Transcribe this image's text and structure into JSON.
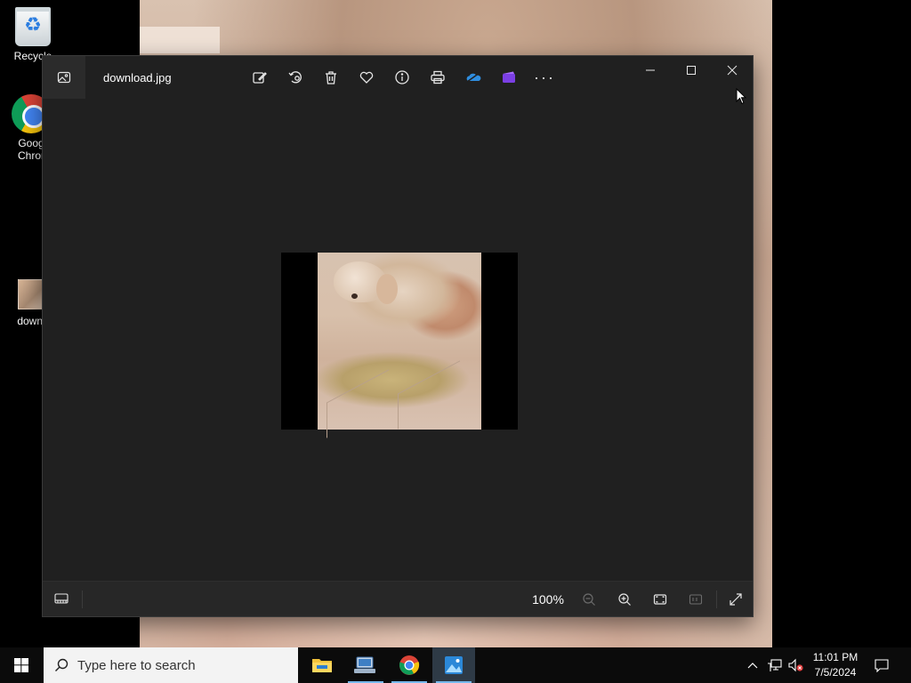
{
  "desktop": {
    "icons": [
      {
        "label": "Recycle",
        "icon": "recycle-bin-icon"
      },
      {
        "label": "Goog\nChror",
        "icon": "chrome-icon"
      },
      {
        "label": "downl",
        "icon": "image-file-icon"
      }
    ]
  },
  "window": {
    "title": "download.jpg",
    "toolbar": [
      {
        "name": "edit-create-button",
        "icon": "edit-create-icon"
      },
      {
        "name": "rotate-button",
        "icon": "rotate-icon"
      },
      {
        "name": "delete-button",
        "icon": "trash-icon"
      },
      {
        "name": "favorite-button",
        "icon": "heart-icon"
      },
      {
        "name": "info-button",
        "icon": "info-icon"
      },
      {
        "name": "print-button",
        "icon": "printer-icon"
      },
      {
        "name": "onedrive-button",
        "icon": "onedrive-icon"
      },
      {
        "name": "clipchamp-button",
        "icon": "clipchamp-icon"
      },
      {
        "name": "more-button",
        "icon": "more-icon",
        "label": "···"
      }
    ],
    "caption_buttons": [
      "minimize",
      "maximize",
      "close"
    ],
    "bottom_bar": {
      "zoom_level": "100%",
      "buttons": [
        "filmstrip",
        "zoom-out",
        "zoom-in",
        "fit-to-window",
        "actual-size",
        "full-screen"
      ]
    },
    "image": {
      "name": "download.jpg",
      "description_icon": "dog-photo"
    }
  },
  "taskbar": {
    "search_placeholder": "Type here to search",
    "apps": [
      {
        "name": "file-explorer",
        "running": false
      },
      {
        "name": "network-tool",
        "running": true
      },
      {
        "name": "chrome",
        "running": true
      },
      {
        "name": "photos",
        "running": true,
        "active": true
      }
    ],
    "clock": {
      "time": "11:01 PM",
      "date": "7/5/2024"
    }
  },
  "colors": {
    "window_bg": "#202020",
    "bottombar_bg": "#272727",
    "taskbar_bg": "#0b0b0b",
    "search_bg": "#f3f3f3",
    "accent": "#76b9ed"
  }
}
